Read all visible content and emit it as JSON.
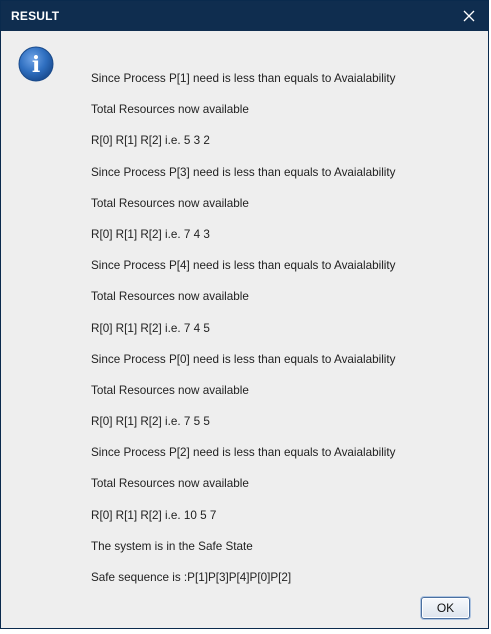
{
  "dialog": {
    "title": "RESULT",
    "close_icon": "close-icon",
    "info_icon": "info-icon",
    "info_icon_glyph": "i",
    "accent": "#0f2d4f",
    "icon_color": "#2f6fc0",
    "ok_label": "OK"
  },
  "messages": [
    "Since Process P[1] need is less than equals to Avaialability",
    "Total Resources now available",
    "R[0] R[1] R[2] i.e. 5 3 2",
    "Since Process P[3] need is less than equals to Avaialability",
    "Total Resources now available",
    "R[0] R[1] R[2] i.e. 7 4 3",
    "Since Process P[4] need is less than equals to Avaialability",
    "Total Resources now available",
    "R[0] R[1] R[2] i.e. 7 4 5",
    "Since Process P[0] need is less than equals to Avaialability",
    "Total Resources now available",
    "R[0] R[1] R[2] i.e. 7 5 5",
    "Since Process P[2] need is less than equals to Avaialability",
    "Total Resources now available",
    "R[0] R[1] R[2] i.e. 10 5 7",
    "The system is in the Safe State",
    "Safe sequence is :P[1]P[3]P[4]P[0]P[2]"
  ]
}
